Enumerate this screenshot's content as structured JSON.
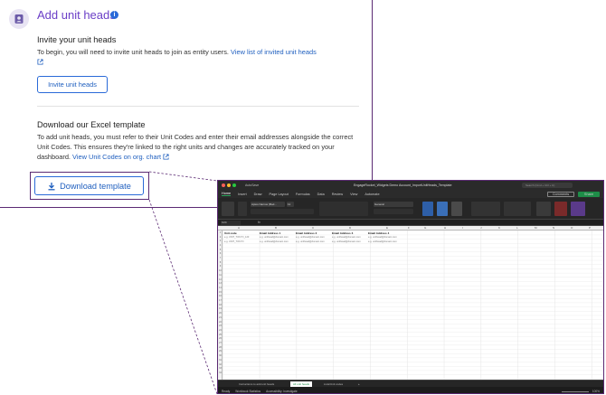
{
  "card": {
    "title": "Add unit heads",
    "invite": {
      "heading": "Invite your unit heads",
      "text": "To begin, you will need to invite unit heads to join as entity users. ",
      "link": "View list of invited unit heads",
      "button": "Invite unit heads"
    },
    "template": {
      "heading": "Download our Excel template",
      "text": "To add unit heads, you must refer to their Unit Codes and enter their email addresses alongside the correct Unit Codes. This ensures they're linked to the right units and changes are accurately tracked on your dashboard. ",
      "link": "View Unit Codes on org. chart",
      "button": "Download template"
    }
  },
  "colors": {
    "accent_purple": "#6b3fc7",
    "frame_purple": "#5b2a73",
    "link_blue": "#1f5fbf",
    "excel_green": "#1e8d48"
  },
  "icons": {
    "avatar": "person-card-icon",
    "info": "info-icon",
    "external": "external-link-icon",
    "download": "download-icon"
  },
  "excel": {
    "autosave": "AutoSave",
    "filename": "EngageRocket_Widgets Demo Account_ImportUnitHeads_Template",
    "search": "Search (Cmd + Ctrl + U)",
    "menu": [
      "Home",
      "Insert",
      "Draw",
      "Page Layout",
      "Formulas",
      "Data",
      "Review",
      "View",
      "Automate"
    ],
    "comments": "Comments",
    "share": "Share",
    "font_name": "Aptos Narrow (Bod...",
    "font_size": "11",
    "number_format": "General",
    "name_box": "C24",
    "fx": "fx",
    "columns": [
      "A",
      "B",
      "C",
      "D",
      "E",
      "F",
      "G",
      "H",
      "I",
      "J",
      "K",
      "L",
      "M",
      "N",
      "O",
      "P"
    ],
    "headers": [
      "Unit code",
      "Email Address 1",
      "Email Address 2",
      "Email Address 3",
      "Email Address 4"
    ],
    "rows": [
      [
        "e.g. UNIT_TOKYO_123",
        "e.g. unithead@domain.com",
        "e.g. unithead@domain.com",
        "e.g. unithead@domain.com",
        "e.g. unithead@domain.com"
      ],
      [
        "e.g. UNIT_TOKYO",
        "e.g. unithead@domain.com",
        "e.g. unithead@domain.com",
        "e.g. unithead@domain.com",
        "e.g. unithead@domain.com"
      ]
    ],
    "sheet_tabs": [
      "Instructions to add unit heads",
      "All unit heads",
      "Lists/Unit codes"
    ],
    "status": [
      "Ready",
      "Workbook Statistics",
      "Accessibility: Investigate"
    ],
    "zoom": "100%"
  }
}
